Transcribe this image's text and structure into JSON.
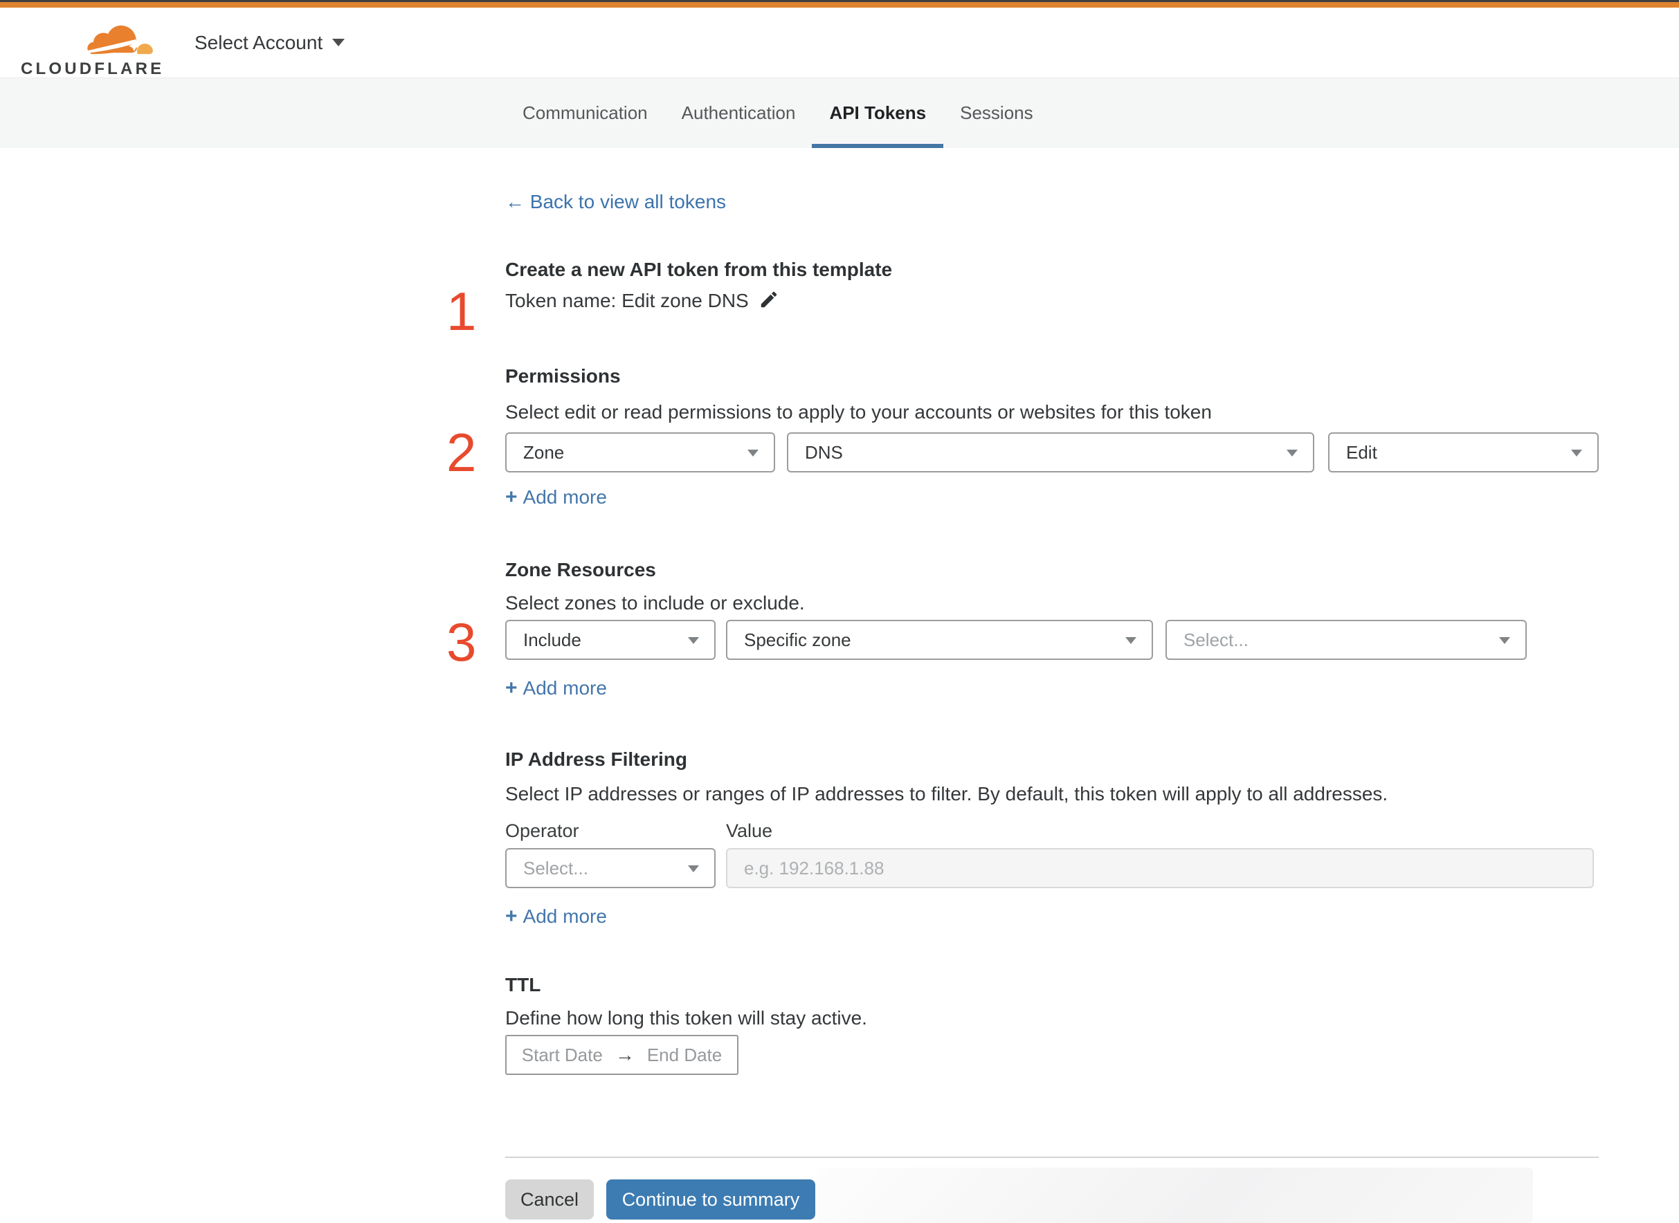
{
  "header": {
    "logo_text": "CLOUDFLARE",
    "account_selector_label": "Select Account"
  },
  "nav": {
    "tabs": [
      {
        "label": "Communication",
        "active": false
      },
      {
        "label": "Authentication",
        "active": false
      },
      {
        "label": "API Tokens",
        "active": true
      },
      {
        "label": "Sessions",
        "active": false
      }
    ]
  },
  "back_link": {
    "label": "Back to view all tokens"
  },
  "step1": {
    "number": "1",
    "title": "Create a new API token from this template",
    "token_name_line": "Token name: Edit zone DNS"
  },
  "permissions": {
    "number": "2",
    "heading": "Permissions",
    "description": "Select edit or read permissions to apply to your accounts or websites for this token",
    "dropdowns": [
      {
        "value": "Zone",
        "is_placeholder": false
      },
      {
        "value": "DNS",
        "is_placeholder": false
      },
      {
        "value": "Edit",
        "is_placeholder": false
      }
    ],
    "add_more_label": "Add more"
  },
  "zone_resources": {
    "number": "3",
    "heading": "Zone Resources",
    "description": "Select zones to include or exclude.",
    "dropdowns": [
      {
        "value": "Include",
        "is_placeholder": false
      },
      {
        "value": "Specific zone",
        "is_placeholder": false
      },
      {
        "value": "Select...",
        "is_placeholder": true
      }
    ],
    "add_more_label": "Add more"
  },
  "ip_filtering": {
    "heading": "IP Address Filtering",
    "description": "Select IP addresses or ranges of IP addresses to filter. By default, this token will apply to all addresses.",
    "operator_label": "Operator",
    "value_label": "Value",
    "operator_dropdown_value": "Select...",
    "value_placeholder": "e.g. 192.168.1.88",
    "add_more_label": "Add more"
  },
  "ttl": {
    "heading": "TTL",
    "description": "Define how long this token will stay active.",
    "start_label": "Start Date",
    "end_label": "End Date"
  },
  "footer": {
    "cancel_label": "Cancel",
    "continue_label": "Continue to summary"
  },
  "icons": {
    "back_arrow": "←",
    "plus": "+",
    "range_arrow": "→",
    "edit_pencil": "pencil-icon",
    "dropdown_caret": "caret-down-icon"
  },
  "colors": {
    "top_bar_orange": "#df832f",
    "brand_orange": "#e8802e",
    "brand_light_orange": "#f1a94e",
    "link_blue": "#3c73ad",
    "tab_underline_blue": "#4477a4",
    "continue_button_blue": "#3d7cb2",
    "step_number_red": "#e84a2e",
    "nav_background": "#f5f6f6"
  }
}
